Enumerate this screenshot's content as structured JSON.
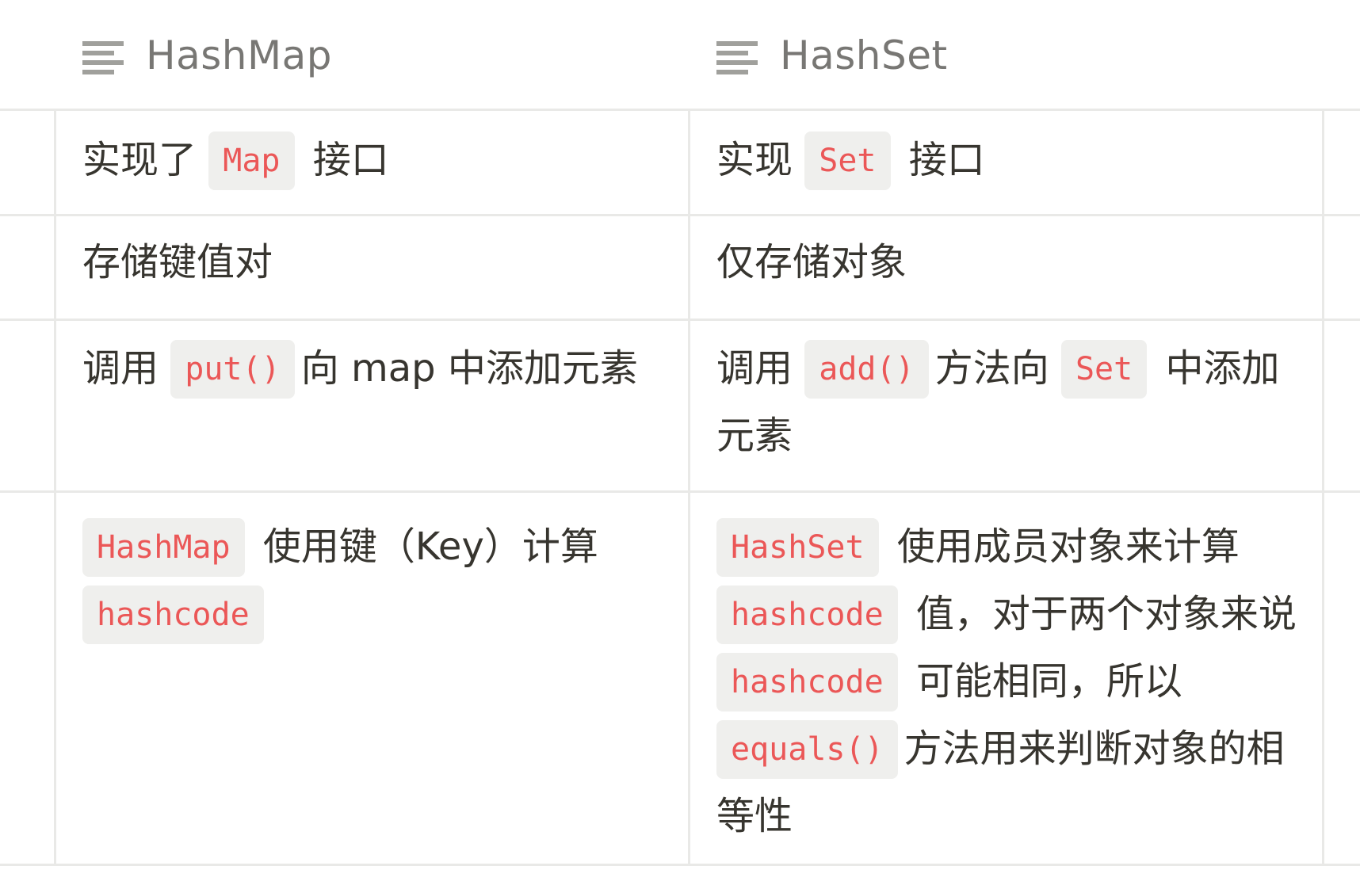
{
  "header": {
    "col1": {
      "icon": "text-lines-icon",
      "label": "HashMap"
    },
    "col2": {
      "icon": "text-lines-icon",
      "label": "HashSet"
    }
  },
  "rows": [
    {
      "col1": {
        "a": "实现了 ",
        "code1": "Map",
        "b": " 接口"
      },
      "col2": {
        "a": "实现 ",
        "code1": "Set",
        "b": " 接口"
      }
    },
    {
      "col1": {
        "a": "存储键值对"
      },
      "col2": {
        "a": "仅存储对象"
      }
    },
    {
      "col1": {
        "a": "调用 ",
        "code1": "put()",
        "b": "向 map 中添加元素"
      },
      "col2": {
        "a": "调用 ",
        "code1": "add()",
        "b": "方法向 ",
        "code2": "Set",
        "c": " 中添加元素"
      }
    },
    {
      "col1": {
        "code1": "HashMap",
        "a": " 使用键（Key）计算 ",
        "code2": "hashcode"
      },
      "col2": {
        "code1": "HashSet",
        "a": " 使用成员对象来计算 ",
        "code2": "hashcode",
        "b": " 值，对于两个对象来说 ",
        "code3": "hashcode",
        "c": " 可能相同，所以",
        "code4": "equals()",
        "d": "方法用来判断对象的相等性"
      }
    }
  ],
  "colors": {
    "code_text": "#eb5757",
    "code_bg": "#efefed",
    "border": "#e9e9e7",
    "header_text": "#787774",
    "body_text": "#37352f"
  }
}
